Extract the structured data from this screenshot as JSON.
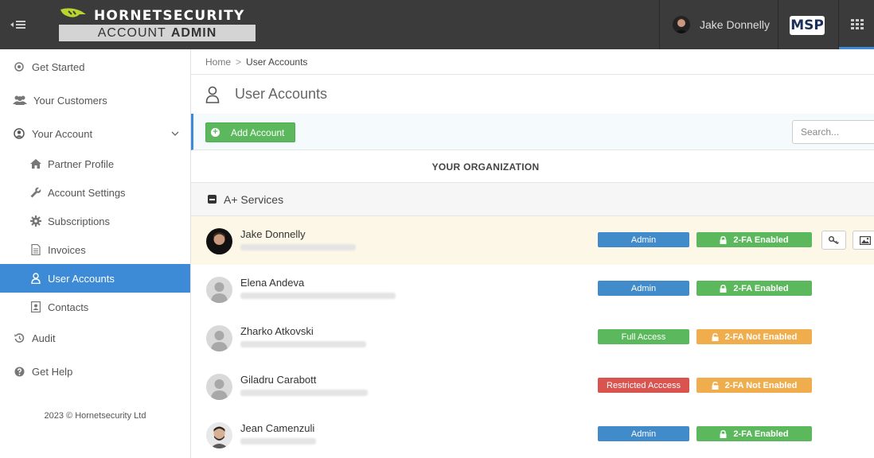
{
  "header": {
    "brand": "HORNETSECURITY",
    "subtitle_light": "ACCOUNT",
    "subtitle_bold": "ADMIN",
    "user_name": "Jake Donnelly",
    "badge": "MSP"
  },
  "sidebar": {
    "items": [
      {
        "label": "Get Started",
        "icon": "target-icon"
      },
      {
        "label": "Your Customers",
        "icon": "users-icon"
      },
      {
        "label": "Your Account",
        "icon": "user-circle-icon"
      },
      {
        "label": "Partner Profile",
        "icon": "home-icon"
      },
      {
        "label": "Account Settings",
        "icon": "wrench-icon"
      },
      {
        "label": "Subscriptions",
        "icon": "gear-icon"
      },
      {
        "label": "Invoices",
        "icon": "document-icon"
      },
      {
        "label": "User Accounts",
        "icon": "user-icon"
      },
      {
        "label": "Contacts",
        "icon": "contact-card-icon"
      },
      {
        "label": "Audit",
        "icon": "history-icon"
      },
      {
        "label": "Get Help",
        "icon": "question-icon"
      }
    ],
    "footer": "2023 © Hornetsecurity Ltd"
  },
  "breadcrumb": {
    "home": "Home",
    "separator": ">",
    "current": "User Accounts"
  },
  "page": {
    "title": "User Accounts"
  },
  "toolbar": {
    "add_label": "Add Account",
    "search_placeholder": "Search..."
  },
  "org_header": "YOUR ORGANIZATION",
  "group": {
    "label": "A+ Services"
  },
  "colors": {
    "admin": "#428bca",
    "full": "#5cb85c",
    "restricted": "#d9534f",
    "enabled": "#5cb85c",
    "not_enabled": "#f0ad4e",
    "accent": "#3d8ad6"
  },
  "users": [
    {
      "name": "Jake Donnelly",
      "role": "Admin",
      "twofa": "2-FA Enabled"
    },
    {
      "name": "Elena Andeva",
      "role": "Admin",
      "twofa": "2-FA Enabled"
    },
    {
      "name": "Zharko Atkovski",
      "role": "Full Access",
      "twofa": "2-FA Not Enabled"
    },
    {
      "name": "Giladru Carabott",
      "role": "Restricted Acccess",
      "twofa": "2-FA Not Enabled"
    },
    {
      "name": "Jean Camenzuli",
      "role": "Admin",
      "twofa": "2-FA Enabled"
    }
  ]
}
